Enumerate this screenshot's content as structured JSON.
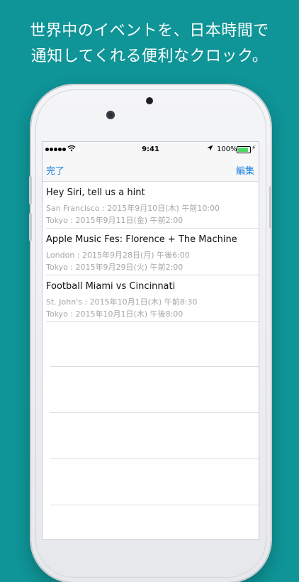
{
  "headline": {
    "line1": "世界中のイベントを、日本時間で",
    "line2": "通知してくれる便利なクロック。"
  },
  "status_bar": {
    "signal_icon": "signal-dots-icon",
    "wifi_icon": "wifi-icon",
    "time": "9:41",
    "location_icon": "location-arrow-icon",
    "battery_percent": "100%",
    "battery_level": 1.0,
    "charging_icon": "charging-bolt-icon"
  },
  "nav": {
    "left_label": "完了",
    "right_label": "編集",
    "accent_color": "#1a7fe3"
  },
  "events": [
    {
      "title": "Hey Siri, tell us a hint",
      "local": "San Francisco : 2015年9月10日(木) 午前10:00",
      "tokyo": "Tokyo : 2015年9月11日(金) 午前2:00"
    },
    {
      "title": "Apple Music Fes: Florence + The Machine",
      "local": "London : 2015年9月28日(月) 午後6:00",
      "tokyo": "Tokyo : 2015年9月29日(火) 午前2:00"
    },
    {
      "title": "Football Miami vs Cincinnati",
      "local": "St. John's : 2015年10月1日(木) 午前8:30",
      "tokyo": "Tokyo : 2015年10月1日(木) 午後8:00"
    }
  ],
  "colors": {
    "background": "#0f9497",
    "secondary_text": "#a5a5aa",
    "battery_green": "#4cd964"
  }
}
